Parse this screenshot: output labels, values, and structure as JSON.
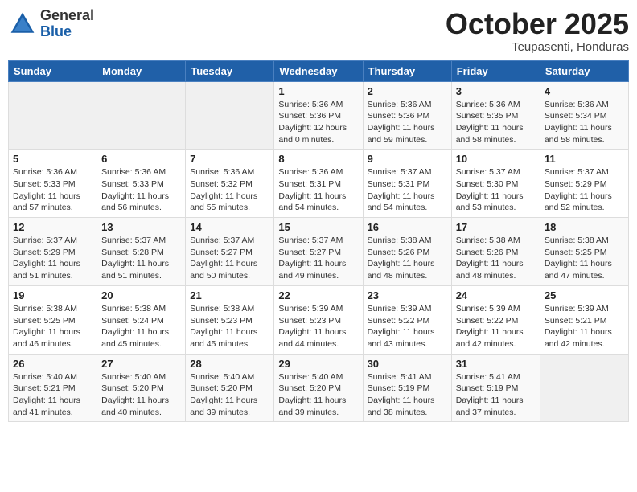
{
  "header": {
    "logo_general": "General",
    "logo_blue": "Blue",
    "month_title": "October 2025",
    "location": "Teupasenti, Honduras"
  },
  "weekdays": [
    "Sunday",
    "Monday",
    "Tuesday",
    "Wednesday",
    "Thursday",
    "Friday",
    "Saturday"
  ],
  "weeks": [
    [
      {
        "day": "",
        "info": ""
      },
      {
        "day": "",
        "info": ""
      },
      {
        "day": "",
        "info": ""
      },
      {
        "day": "1",
        "info": "Sunrise: 5:36 AM\nSunset: 5:36 PM\nDaylight: 12 hours\nand 0 minutes."
      },
      {
        "day": "2",
        "info": "Sunrise: 5:36 AM\nSunset: 5:36 PM\nDaylight: 11 hours\nand 59 minutes."
      },
      {
        "day": "3",
        "info": "Sunrise: 5:36 AM\nSunset: 5:35 PM\nDaylight: 11 hours\nand 58 minutes."
      },
      {
        "day": "4",
        "info": "Sunrise: 5:36 AM\nSunset: 5:34 PM\nDaylight: 11 hours\nand 58 minutes."
      }
    ],
    [
      {
        "day": "5",
        "info": "Sunrise: 5:36 AM\nSunset: 5:33 PM\nDaylight: 11 hours\nand 57 minutes."
      },
      {
        "day": "6",
        "info": "Sunrise: 5:36 AM\nSunset: 5:33 PM\nDaylight: 11 hours\nand 56 minutes."
      },
      {
        "day": "7",
        "info": "Sunrise: 5:36 AM\nSunset: 5:32 PM\nDaylight: 11 hours\nand 55 minutes."
      },
      {
        "day": "8",
        "info": "Sunrise: 5:36 AM\nSunset: 5:31 PM\nDaylight: 11 hours\nand 54 minutes."
      },
      {
        "day": "9",
        "info": "Sunrise: 5:37 AM\nSunset: 5:31 PM\nDaylight: 11 hours\nand 54 minutes."
      },
      {
        "day": "10",
        "info": "Sunrise: 5:37 AM\nSunset: 5:30 PM\nDaylight: 11 hours\nand 53 minutes."
      },
      {
        "day": "11",
        "info": "Sunrise: 5:37 AM\nSunset: 5:29 PM\nDaylight: 11 hours\nand 52 minutes."
      }
    ],
    [
      {
        "day": "12",
        "info": "Sunrise: 5:37 AM\nSunset: 5:29 PM\nDaylight: 11 hours\nand 51 minutes."
      },
      {
        "day": "13",
        "info": "Sunrise: 5:37 AM\nSunset: 5:28 PM\nDaylight: 11 hours\nand 51 minutes."
      },
      {
        "day": "14",
        "info": "Sunrise: 5:37 AM\nSunset: 5:27 PM\nDaylight: 11 hours\nand 50 minutes."
      },
      {
        "day": "15",
        "info": "Sunrise: 5:37 AM\nSunset: 5:27 PM\nDaylight: 11 hours\nand 49 minutes."
      },
      {
        "day": "16",
        "info": "Sunrise: 5:38 AM\nSunset: 5:26 PM\nDaylight: 11 hours\nand 48 minutes."
      },
      {
        "day": "17",
        "info": "Sunrise: 5:38 AM\nSunset: 5:26 PM\nDaylight: 11 hours\nand 48 minutes."
      },
      {
        "day": "18",
        "info": "Sunrise: 5:38 AM\nSunset: 5:25 PM\nDaylight: 11 hours\nand 47 minutes."
      }
    ],
    [
      {
        "day": "19",
        "info": "Sunrise: 5:38 AM\nSunset: 5:25 PM\nDaylight: 11 hours\nand 46 minutes."
      },
      {
        "day": "20",
        "info": "Sunrise: 5:38 AM\nSunset: 5:24 PM\nDaylight: 11 hours\nand 45 minutes."
      },
      {
        "day": "21",
        "info": "Sunrise: 5:38 AM\nSunset: 5:23 PM\nDaylight: 11 hours\nand 45 minutes."
      },
      {
        "day": "22",
        "info": "Sunrise: 5:39 AM\nSunset: 5:23 PM\nDaylight: 11 hours\nand 44 minutes."
      },
      {
        "day": "23",
        "info": "Sunrise: 5:39 AM\nSunset: 5:22 PM\nDaylight: 11 hours\nand 43 minutes."
      },
      {
        "day": "24",
        "info": "Sunrise: 5:39 AM\nSunset: 5:22 PM\nDaylight: 11 hours\nand 42 minutes."
      },
      {
        "day": "25",
        "info": "Sunrise: 5:39 AM\nSunset: 5:21 PM\nDaylight: 11 hours\nand 42 minutes."
      }
    ],
    [
      {
        "day": "26",
        "info": "Sunrise: 5:40 AM\nSunset: 5:21 PM\nDaylight: 11 hours\nand 41 minutes."
      },
      {
        "day": "27",
        "info": "Sunrise: 5:40 AM\nSunset: 5:20 PM\nDaylight: 11 hours\nand 40 minutes."
      },
      {
        "day": "28",
        "info": "Sunrise: 5:40 AM\nSunset: 5:20 PM\nDaylight: 11 hours\nand 39 minutes."
      },
      {
        "day": "29",
        "info": "Sunrise: 5:40 AM\nSunset: 5:20 PM\nDaylight: 11 hours\nand 39 minutes."
      },
      {
        "day": "30",
        "info": "Sunrise: 5:41 AM\nSunset: 5:19 PM\nDaylight: 11 hours\nand 38 minutes."
      },
      {
        "day": "31",
        "info": "Sunrise: 5:41 AM\nSunset: 5:19 PM\nDaylight: 11 hours\nand 37 minutes."
      },
      {
        "day": "",
        "info": ""
      }
    ]
  ]
}
